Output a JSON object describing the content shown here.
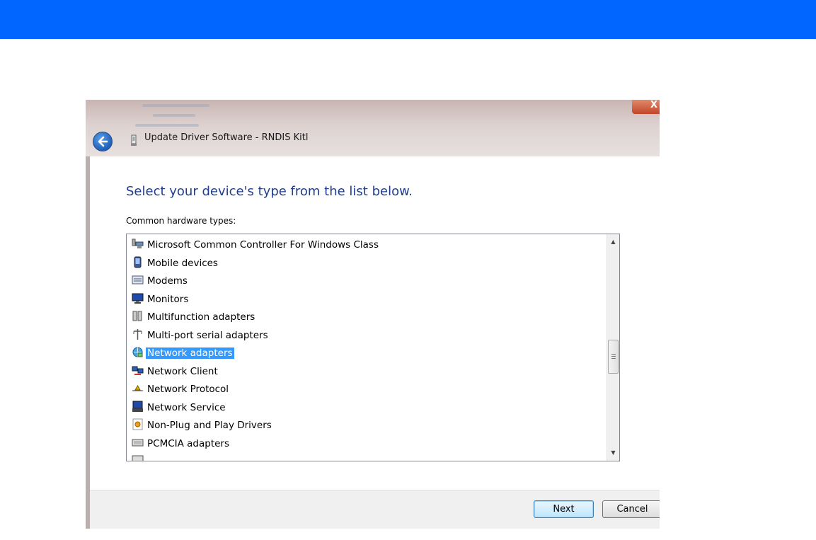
{
  "window": {
    "title": "Update Driver Software - RNDIS Kitl",
    "close_glyph": "X"
  },
  "main": {
    "heading": "Select your device's type from the list below.",
    "list_label": "Common hardware types:",
    "items": [
      {
        "label": "Microsoft Common Controller For Windows Class",
        "icon": "controller-icon",
        "selected": false
      },
      {
        "label": "Mobile devices",
        "icon": "mobile-device-icon",
        "selected": false
      },
      {
        "label": "Modems",
        "icon": "modem-icon",
        "selected": false
      },
      {
        "label": "Monitors",
        "icon": "monitor-icon",
        "selected": false
      },
      {
        "label": "Multifunction adapters",
        "icon": "multifunction-adapter-icon",
        "selected": false
      },
      {
        "label": "Multi-port serial adapters",
        "icon": "serial-port-icon",
        "selected": false
      },
      {
        "label": "Network adapters",
        "icon": "network-adapter-icon",
        "selected": true
      },
      {
        "label": "Network Client",
        "icon": "network-client-icon",
        "selected": false
      },
      {
        "label": "Network Protocol",
        "icon": "network-protocol-icon",
        "selected": false
      },
      {
        "label": "Network Service",
        "icon": "network-service-icon",
        "selected": false
      },
      {
        "label": "Non-Plug and Play Drivers",
        "icon": "driver-icon",
        "selected": false
      },
      {
        "label": "PCMCIA adapters",
        "icon": "pcmcia-icon",
        "selected": false
      }
    ]
  },
  "footer": {
    "next_label": "Next",
    "cancel_label": "Cancel"
  },
  "colors": {
    "top_bar": "#0066ff",
    "heading": "#1e3d8f",
    "selection": "#3399ff"
  }
}
